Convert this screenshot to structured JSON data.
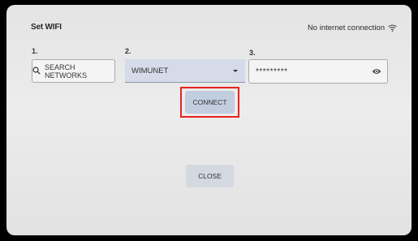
{
  "header": {
    "title": "Set WIFI",
    "status_text": "No internet connection",
    "status_icon": "wifi-icon"
  },
  "steps": {
    "step1": "1.",
    "step2": "2.",
    "step3": "3."
  },
  "search": {
    "label": "SEARCH NETWORKS",
    "icon": "search-icon"
  },
  "network": {
    "selected": "WIMUNET"
  },
  "password": {
    "value": "*********",
    "icon": "eye-icon"
  },
  "actions": {
    "connect_label": "CONNECT",
    "close_label": "CLOSE"
  },
  "colors": {
    "highlight": "#e8231c",
    "button": "#c3cde0",
    "select_bg": "#d5dbe8"
  }
}
